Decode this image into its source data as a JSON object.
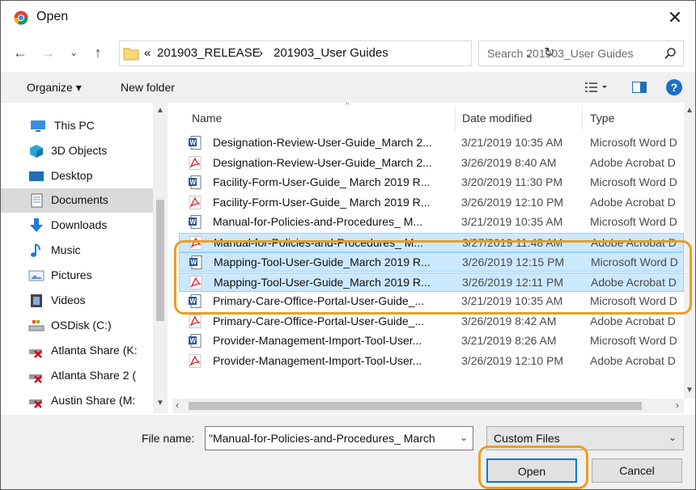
{
  "window": {
    "title": "Open",
    "close_glyph": "✕"
  },
  "nav": {
    "back_glyph": "←",
    "forward_glyph": "→",
    "recent_glyph": "⌄",
    "up_glyph": "↑",
    "breadcrumb": [
      "201903_RELEASE",
      "201903_User Guides"
    ],
    "breadcrumb_prefix": "«",
    "separator": "›",
    "refresh_glyph": "↻",
    "dropdown_glyph": "⌄",
    "search_placeholder": "Search 201903_User Guides"
  },
  "toolbar": {
    "organize_label": "Organize ▾",
    "new_folder_label": "New folder",
    "help_glyph": "?"
  },
  "sidebar": {
    "items": [
      {
        "label": "This PC",
        "icon": "pc-icon"
      },
      {
        "label": "3D Objects",
        "icon": "3d-objects-icon"
      },
      {
        "label": "Desktop",
        "icon": "desktop-icon"
      },
      {
        "label": "Documents",
        "icon": "documents-icon",
        "selected": true
      },
      {
        "label": "Downloads",
        "icon": "downloads-icon"
      },
      {
        "label": "Music",
        "icon": "music-icon"
      },
      {
        "label": "Pictures",
        "icon": "pictures-icon"
      },
      {
        "label": "Videos",
        "icon": "videos-icon"
      },
      {
        "label": "OSDisk (C:)",
        "icon": "drive-icon"
      },
      {
        "label": "Atlanta Share (K:",
        "icon": "network-drive-disconnected-icon"
      },
      {
        "label": "Atlanta Share 2 (",
        "icon": "network-drive-disconnected-icon"
      },
      {
        "label": "Austin Share (M:",
        "icon": "network-drive-disconnected-icon"
      }
    ]
  },
  "columns": {
    "name": "Name",
    "date": "Date modified",
    "type": "Type"
  },
  "files": [
    {
      "name": "Designation-Review-User-Guide_March 2...",
      "date": "3/21/2019 10:35 AM",
      "type": "Microsoft Word D",
      "kind": "word"
    },
    {
      "name": "Designation-Review-User-Guide_March 2...",
      "date": "3/26/2019 8:40 AM",
      "type": "Adobe Acrobat D",
      "kind": "pdf"
    },
    {
      "name": "Facility-Form-User-Guide_ March 2019 R...",
      "date": "3/20/2019 11:30 PM",
      "type": "Microsoft Word D",
      "kind": "word"
    },
    {
      "name": "Facility-Form-User-Guide_ March 2019 R...",
      "date": "3/26/2019 12:10 PM",
      "type": "Adobe Acrobat D",
      "kind": "pdf"
    },
    {
      "name": "Manual-for-Policies-and-Procedures_ M...",
      "date": "3/21/2019 10:35 AM",
      "type": "Microsoft Word D",
      "kind": "word"
    },
    {
      "name": "Manual-for-Policies-and-Procedures_ M...",
      "date": "3/27/2019 11:48 AM",
      "type": "Adobe Acrobat D",
      "kind": "pdf",
      "selected": true
    },
    {
      "name": "Mapping-Tool-User-Guide_March 2019 R...",
      "date": "3/26/2019 12:15 PM",
      "type": "Microsoft Word D",
      "kind": "word",
      "selected": true
    },
    {
      "name": "Mapping-Tool-User-Guide_March 2019 R...",
      "date": "3/26/2019 12:11 PM",
      "type": "Adobe Acrobat D",
      "kind": "pdf",
      "selected": true
    },
    {
      "name": "Primary-Care-Office-Portal-User-Guide_...",
      "date": "3/21/2019 10:35 AM",
      "type": "Microsoft Word D",
      "kind": "word"
    },
    {
      "name": "Primary-Care-Office-Portal-User-Guide_...",
      "date": "3/26/2019 8:42 AM",
      "type": "Adobe Acrobat D",
      "kind": "pdf"
    },
    {
      "name": "Provider-Management-Import-Tool-User...",
      "date": "3/21/2019 8:26 AM",
      "type": "Microsoft Word D",
      "kind": "word"
    },
    {
      "name": "Provider-Management-Import-Tool-User...",
      "date": "3/26/2019 12:10 PM",
      "type": "Adobe Acrobat D",
      "kind": "pdf"
    }
  ],
  "footer": {
    "file_name_label": "File name:",
    "file_name_value": "\"Manual-for-Policies-and-Procedures_ March",
    "file_type_value": "Custom Files",
    "open_label": "Open",
    "cancel_label": "Cancel"
  },
  "colors": {
    "selection_bg": "#cce8ff",
    "highlight": "#e8a020",
    "accent": "#0078d7"
  }
}
